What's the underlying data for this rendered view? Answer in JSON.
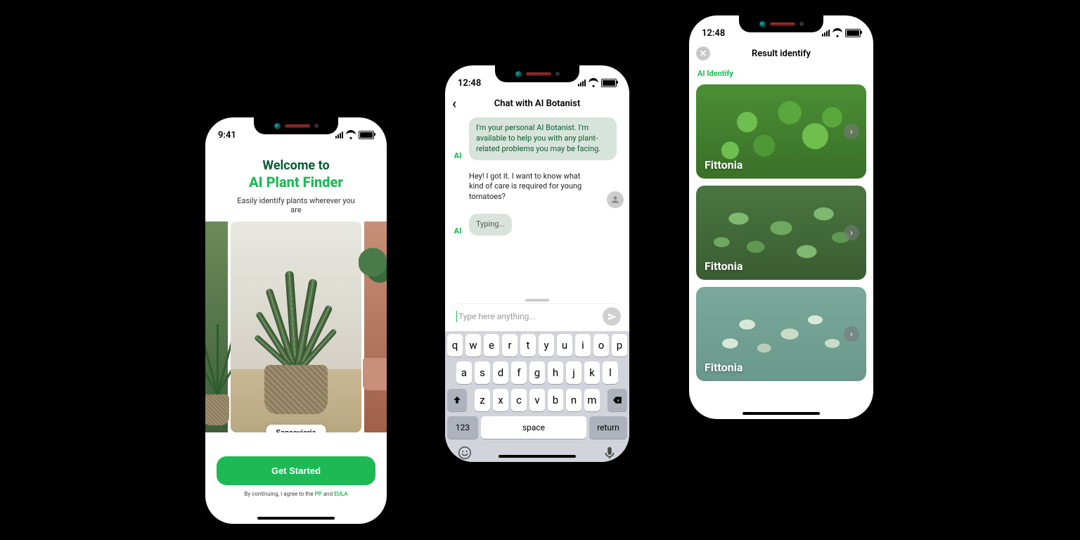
{
  "phone1": {
    "status_time": "9:41",
    "welcome_line1": "Welcome to",
    "welcome_line2": "AI Plant Finder",
    "subtitle": "Easily identify plants wherever you are",
    "plant_name": "Sansevieria",
    "cta": "Get Started",
    "legal_prefix": "By continuing, I agree to the ",
    "legal_pp": "PP",
    "legal_and": " and ",
    "legal_eula": "EULA"
  },
  "phone2": {
    "status_time": "12:48",
    "title": "Chat with AI Botanist",
    "ai_label": "AI",
    "bot_msg": "I'm your personal AI Botanist. I'm available to help you with any plant-related problems you may be facing.",
    "user_msg": "Hey! I got it. I want to know what kind of care is required for young tomatoes?",
    "typing": "Typing...",
    "placeholder": "Type here anything...",
    "keyboard": {
      "row1": [
        "q",
        "w",
        "e",
        "r",
        "t",
        "y",
        "u",
        "i",
        "o",
        "p"
      ],
      "row2": [
        "a",
        "s",
        "d",
        "f",
        "g",
        "h",
        "j",
        "k",
        "l"
      ],
      "row3": [
        "z",
        "x",
        "c",
        "v",
        "b",
        "n",
        "m"
      ],
      "num": "123",
      "space": "space",
      "return": "return"
    }
  },
  "phone3": {
    "status_time": "12:48",
    "title": "Result identify",
    "section": "AI Identify",
    "results": [
      {
        "name": "Fittonia"
      },
      {
        "name": "Fittonia"
      },
      {
        "name": "Fittonia"
      }
    ]
  }
}
